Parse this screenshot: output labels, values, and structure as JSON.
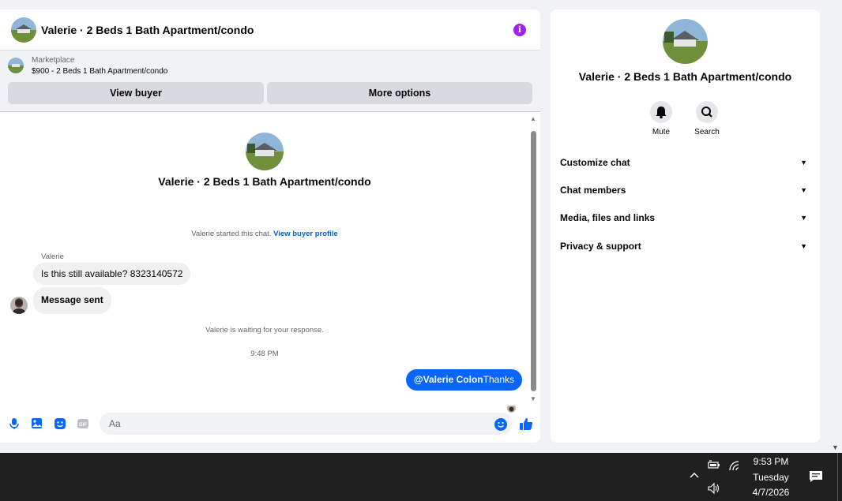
{
  "chat": {
    "title": "Valerie · 2 Beds 1 Bath Apartment/condo",
    "info_icon": "info-icon",
    "marketplace": {
      "label": "Marketplace",
      "listing": "$900 - 2 Beds 1 Bath Apartment/condo",
      "view_buyer": "View buyer",
      "more_options": "More options"
    },
    "conversation": {
      "title": "Valerie · 2 Beds 1 Bath Apartment/condo",
      "started_text": "Valerie started this chat.",
      "view_buyer_profile": "View buyer profile",
      "sender_name": "Valerie",
      "messages_in": [
        "Is this still available? 8323140572",
        "Message sent"
      ],
      "waiting_text": "Valerie is waiting for your response.",
      "timestamp": "9:48 PM",
      "outgoing_mention": "@Valerie Colon",
      "outgoing_text": "Thanks"
    },
    "composer": {
      "placeholder": "Aa",
      "icons": [
        "microphone-icon",
        "image-icon",
        "sticker-icon",
        "gif-icon",
        "emoji-icon",
        "thumbs-up-icon"
      ]
    }
  },
  "info_panel": {
    "title": "Valerie · 2 Beds 1 Bath Apartment/condo",
    "actions": {
      "mute": "Mute",
      "search": "Search"
    },
    "sections": [
      "Customize chat",
      "Chat members",
      "Media, files and links",
      "Privacy & support"
    ]
  },
  "taskbar": {
    "time": "9:53 PM",
    "day": "Tuesday",
    "date": "4/7/2026"
  },
  "colors": {
    "accent": "#0866ff",
    "info": "#a020f0",
    "bubble_in": "#f0f0f0",
    "taskbar": "#202020"
  }
}
